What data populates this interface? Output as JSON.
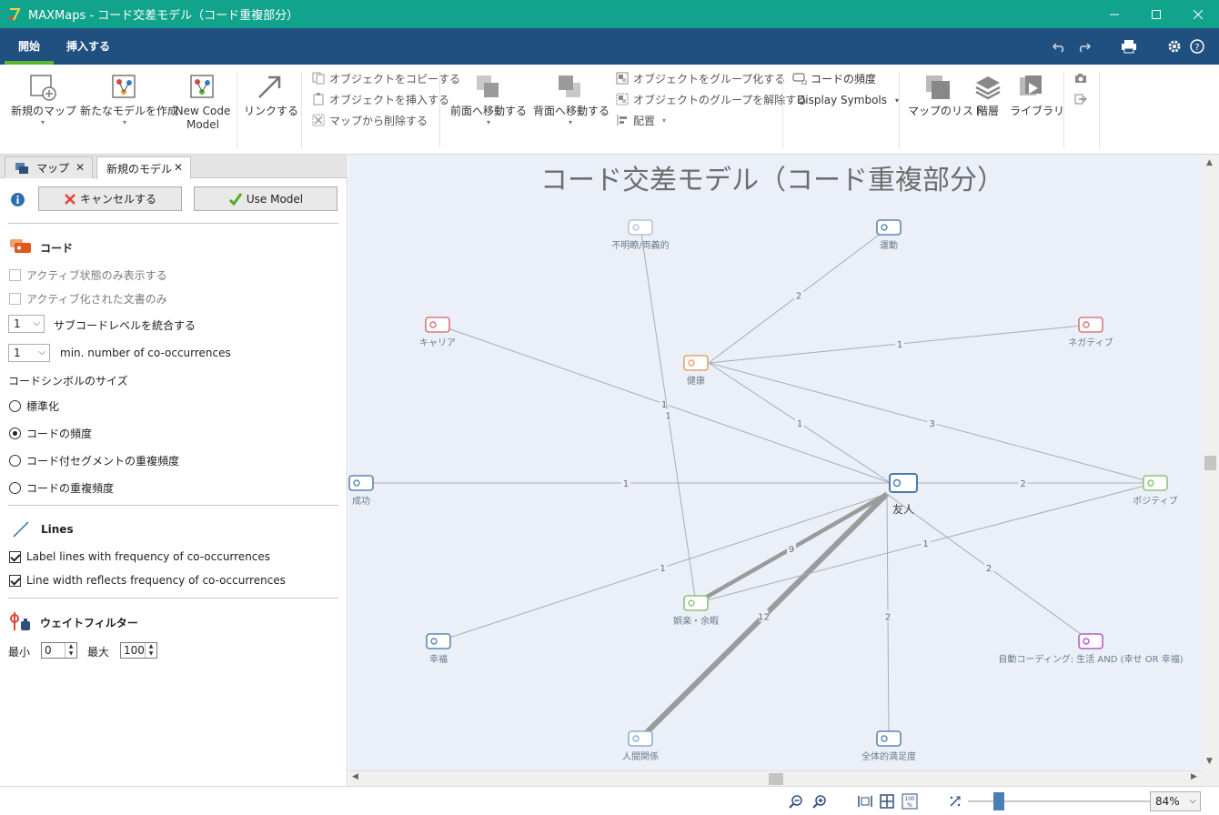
{
  "window": {
    "title": "MAXMaps - コード交差モデル（コード重複部分）",
    "title_color": "#12a38d"
  },
  "ribbon_tabs": [
    {
      "label": "開始",
      "active": true
    },
    {
      "label": "挿入する",
      "active": false
    }
  ],
  "ribbon": {
    "new_map": "新規のマップ",
    "new_model": "新たなモデルを作成",
    "new_code_model_1": "New Code",
    "new_code_model_2": "Model",
    "link": "リンクする",
    "copy_object": "オブジェクトをコピーする",
    "insert_object": "オブジェクトを挿入する",
    "remove_from_map": "マップから削除する",
    "bring_forward": "前面へ移動する",
    "send_backward": "背面へ移動する",
    "group_objects": "オブジェクトをグループ化する",
    "ungroup_objects": "オブジェクトのグループを解除する",
    "arrange": "配置",
    "code_frequency": "コードの頻度",
    "display_symbols": "Display Symbols",
    "map_list": "マップのリスト",
    "layers": "階層",
    "library": "ライブラリ"
  },
  "panel_tabs": [
    {
      "label": "マップ",
      "active": false
    },
    {
      "label": "新規のモデル",
      "active": true
    }
  ],
  "panel": {
    "cancel_label": "キャンセルする",
    "use_model_label": "Use Model",
    "codes_title": "コード",
    "only_active_label": "アクティブ状態のみ表示する",
    "only_active_docs_label": "アクティブ化された文書のみ",
    "subcode_level_value": "1",
    "subcode_level_label": "サブコードレベルを統合する",
    "min_cooc_value": "1",
    "min_cooc_label": "min. number of co-occurrences",
    "symbol_size_label": "コードシンボルのサイズ",
    "radio_options": [
      {
        "label": "標準化",
        "checked": false
      },
      {
        "label": "コードの頻度",
        "checked": true
      },
      {
        "label": "コード付セグメントの重複頻度",
        "checked": false
      },
      {
        "label": "コードの重複頻度",
        "checked": false
      }
    ],
    "lines_title": "Lines",
    "label_lines": "Label lines with frequency of co-occurrences",
    "line_width": "Line width reflects frequency of co-occurrences",
    "weight_filter_title": "ウェイトフィルター",
    "min_label": "最小",
    "min_value": "0",
    "max_label": "最大",
    "max_value": "100"
  },
  "map": {
    "title": "コード交差モデル（コード重複部分）",
    "nodes": {
      "unclear": "不明瞭/両義的",
      "exercise": "運動",
      "career": "キャリア",
      "negative": "ネガティブ",
      "health": "健康",
      "success": "成功",
      "friend": "友人",
      "positive": "ポジティブ",
      "leisure": "娯楽・余暇",
      "happiness": "幸福",
      "autocode": "自動コーディング: 生活 AND (幸せ OR 幸福)",
      "relationships": "人間関係",
      "satisfaction": "全体的満足度"
    },
    "edges": [
      {
        "from": "health",
        "to": "exercise",
        "weight": 2
      },
      {
        "from": "health",
        "to": "negative",
        "weight": 1
      },
      {
        "from": "health",
        "to": "friend",
        "weight": 1
      },
      {
        "from": "health",
        "to": "positive",
        "weight": 3
      },
      {
        "from": "career",
        "to": "friend",
        "weight": 1
      },
      {
        "from": "unclear",
        "to": "leisure",
        "weight": 1
      },
      {
        "from": "success",
        "to": "friend",
        "weight": 1
      },
      {
        "from": "friend",
        "to": "positive",
        "weight": 2
      },
      {
        "from": "friend",
        "to": "happiness",
        "weight": 1
      },
      {
        "from": "friend",
        "to": "leisure",
        "weight": 9
      },
      {
        "from": "friend",
        "to": "relationships",
        "weight": 12
      },
      {
        "from": "friend",
        "to": "autocode",
        "weight": 2
      },
      {
        "from": "friend",
        "to": "satisfaction",
        "weight": 2
      },
      {
        "from": "leisure",
        "to": "positive",
        "weight": 1
      }
    ]
  },
  "status": {
    "zoom": "84%",
    "zoom_fraction": 0.17
  }
}
